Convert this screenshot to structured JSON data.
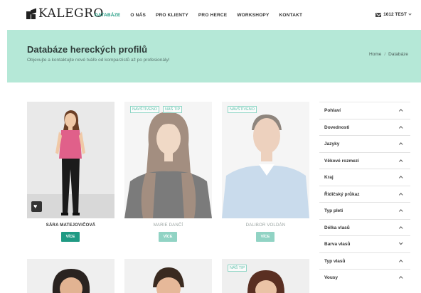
{
  "header": {
    "logo_text": "KALEGRO",
    "nav": [
      {
        "label": "DATABÁZE",
        "active": true
      },
      {
        "label": "O NÁS",
        "active": false
      },
      {
        "label": "PRO KLIENTY",
        "active": false
      },
      {
        "label": "PRO HERCE",
        "active": false
      },
      {
        "label": "WORKSHOPY",
        "active": false
      },
      {
        "label": "KONTAKT",
        "active": false
      }
    ],
    "user": {
      "icon": "mail-icon",
      "label": "1612 TEST"
    }
  },
  "banner": {
    "title": "Databáze hereckých profilů",
    "subtitle": "Objevujte a kontaktujte nové tváře od komparzistů až po profesionály!",
    "breadcrumb": [
      "Home",
      "Databáze"
    ],
    "color": "#b5e8d7"
  },
  "profiles": [
    {
      "name": "SÁRA MATEJOVIČOVÁ",
      "tags": [],
      "button": "VÍCE",
      "highlight": true
    },
    {
      "name": "MARIE DANČÍ",
      "tags": [
        "NAVŠTÍVENO",
        "NÁŠ TIP"
      ],
      "button": "VÍCE",
      "highlight": false
    },
    {
      "name": "DALIBOR VOLDÁN",
      "tags": [
        "NAVŠTÍVENO"
      ],
      "button": "VÍCE",
      "highlight": false
    },
    {
      "name": "",
      "tags": [],
      "button": "",
      "highlight": false
    },
    {
      "name": "",
      "tags": [],
      "button": "",
      "highlight": false
    },
    {
      "name": "",
      "tags": [
        "NÁŠ TIP"
      ],
      "button": "",
      "highlight": false
    }
  ],
  "filters": [
    {
      "label": "Pohlaví",
      "expanded": true
    },
    {
      "label": "Dovednosti",
      "expanded": true
    },
    {
      "label": "Jazyky",
      "expanded": true
    },
    {
      "label": "Věkové rozmezí",
      "expanded": true
    },
    {
      "label": "Kraj",
      "expanded": true
    },
    {
      "label": "Řidičský průkaz",
      "expanded": true
    },
    {
      "label": "Typ pleti",
      "expanded": true
    },
    {
      "label": "Délka vlasů",
      "expanded": true
    },
    {
      "label": "Barva vlasů",
      "expanded": false
    },
    {
      "label": "Typ vlasů",
      "expanded": true
    },
    {
      "label": "Vousy",
      "expanded": true
    }
  ],
  "accent_color": "#1d9a80"
}
